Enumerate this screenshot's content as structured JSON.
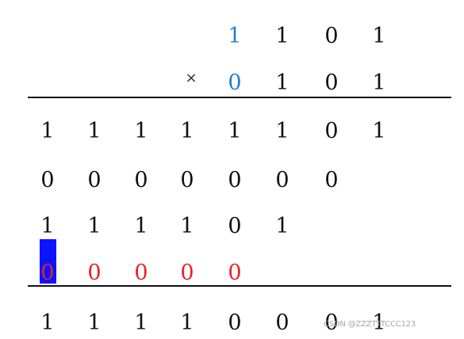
{
  "colors": {
    "default": "#111111",
    "highlight_blue": "#1e7fd0",
    "partial_red": "#e8202a",
    "marker_blue": "#0a14ff"
  },
  "multiplication_sign": "×",
  "multiplicand": [
    "1",
    "1",
    "0",
    "1"
  ],
  "multiplier": [
    "0",
    "1",
    "0",
    "1"
  ],
  "partial_products": [
    [
      "1",
      "1",
      "1",
      "1",
      "1",
      "1",
      "0",
      "1"
    ],
    [
      "0",
      "0",
      "0",
      "0",
      "0",
      "0",
      "0"
    ],
    [
      "1",
      "1",
      "1",
      "1",
      "0",
      "1"
    ],
    [
      "0",
      "0",
      "0",
      "0",
      "0"
    ]
  ],
  "result": [
    "1",
    "1",
    "1",
    "1",
    "0",
    "0",
    "0",
    "1"
  ],
  "watermark": "CSDN @ZZZTTTCCC123"
}
